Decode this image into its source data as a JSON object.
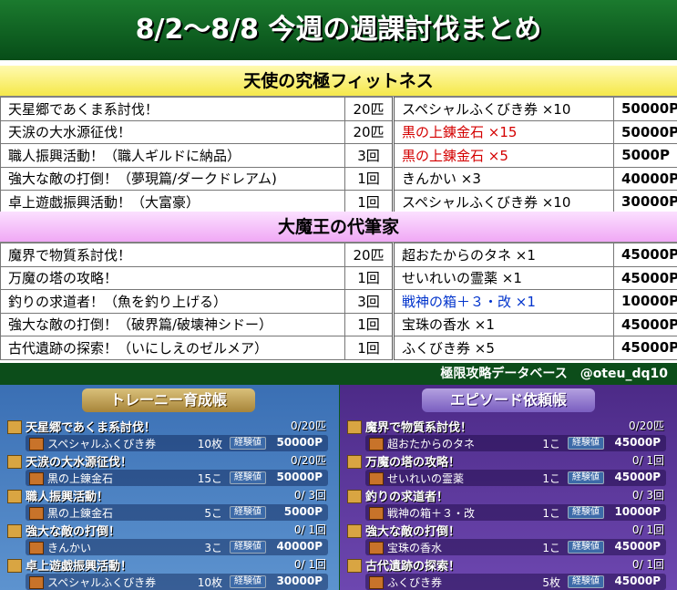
{
  "header": {
    "title": "8/2〜8/8 今週の週課討伐まとめ"
  },
  "sections": [
    {
      "title": "天使の究極フィットネス",
      "rows": [
        {
          "name": "天星郷であくま系討伐！",
          "count": "20匹",
          "reward": "スペシャルふくびき券 ×10",
          "points": "50000P",
          "color": ""
        },
        {
          "name": "天涙の大水源征伐！",
          "count": "20匹",
          "reward": "黒の上錬金石 ×15",
          "points": "50000P",
          "color": "red"
        },
        {
          "name": "職人振興活動！（職人ギルドに納品）",
          "count": "3回",
          "reward": "黒の上錬金石 ×5",
          "points": "5000P",
          "color": "red"
        },
        {
          "name": "強大な敵の打倒！（夢現篇/ダークドレアム)",
          "count": "1回",
          "reward": "きんかい ×3",
          "points": "40000P",
          "color": ""
        },
        {
          "name": "卓上遊戯振興活動！（大富豪）",
          "count": "1回",
          "reward": "スペシャルふくびき券 ×10",
          "points": "30000P",
          "color": ""
        }
      ]
    },
    {
      "title": "大魔王の代筆家",
      "rows": [
        {
          "name": "魔界で物質系討伐！",
          "count": "20匹",
          "reward": "超おたからのタネ ×1",
          "points": "45000P",
          "color": ""
        },
        {
          "name": "万魔の塔の攻略！",
          "count": "1回",
          "reward": "せいれいの霊薬 ×1",
          "points": "45000P",
          "color": ""
        },
        {
          "name": "釣りの求道者！（魚を釣り上げる）",
          "count": "3回",
          "reward": "戦神の箱＋３・改 ×1",
          "points": "10000P",
          "color": "blue"
        },
        {
          "name": "強大な敵の打倒！（破界篇/破壊神シドー）",
          "count": "1回",
          "reward": "宝珠の香水 ×1",
          "points": "45000P",
          "color": ""
        },
        {
          "name": "古代遺跡の探索！（いにしえのゼルメア）",
          "count": "1回",
          "reward": "ふくびき券 ×5",
          "points": "45000P",
          "color": ""
        }
      ]
    }
  ],
  "footer": {
    "credit": "極限攻略データベース　@oteu_dq10"
  },
  "game": {
    "left": {
      "tab": "トレーニー育成帳",
      "exp_label": "経験値",
      "rows": [
        {
          "quest": "天星郷であくま系討伐！",
          "progress": "0/20匹",
          "item": "スペシャルふくびき券",
          "qty": "10枚",
          "points": "50000P"
        },
        {
          "quest": "天涙の大水源征伐！",
          "progress": "0/20匹",
          "item": "黒の上錬金石",
          "qty": "15こ",
          "points": "50000P"
        },
        {
          "quest": "職人振興活動！",
          "progress": "0/ 3回",
          "item": "黒の上錬金石",
          "qty": "5こ",
          "points": "5000P"
        },
        {
          "quest": "強大な敵の打倒！",
          "progress": "0/ 1回",
          "item": "きんかい",
          "qty": "3こ",
          "points": "40000P"
        },
        {
          "quest": "卓上遊戯振興活動！",
          "progress": "0/ 1回",
          "item": "スペシャルふくびき券",
          "qty": "10枚",
          "points": "30000P"
        }
      ]
    },
    "right": {
      "tab": "エピソード依頼帳",
      "exp_label": "経験値",
      "rows": [
        {
          "quest": "魔界で物質系討伐！",
          "progress": "0/20匹",
          "item": "超おたからのタネ",
          "qty": "1こ",
          "points": "45000P"
        },
        {
          "quest": "万魔の塔の攻略！",
          "progress": "0/ 1回",
          "item": "せいれいの霊薬",
          "qty": "1こ",
          "points": "45000P"
        },
        {
          "quest": "釣りの求道者！",
          "progress": "0/ 3回",
          "item": "戦神の箱＋３・改",
          "qty": "1こ",
          "points": "10000P"
        },
        {
          "quest": "強大な敵の打倒！",
          "progress": "0/ 1回",
          "item": "宝珠の香水",
          "qty": "1こ",
          "points": "45000P"
        },
        {
          "quest": "古代遺跡の探索！",
          "progress": "0/ 1回",
          "item": "ふくびき券",
          "qty": "5枚",
          "points": "45000P"
        }
      ]
    }
  }
}
